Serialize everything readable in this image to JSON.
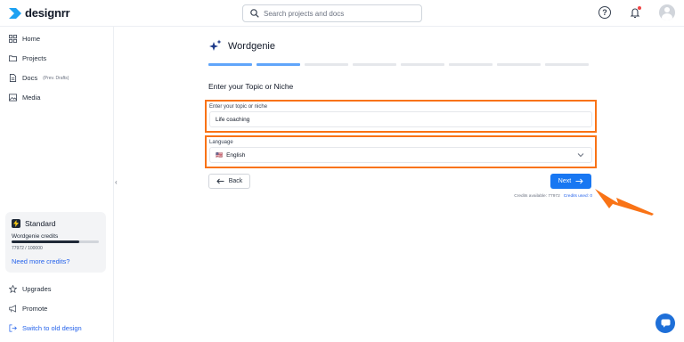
{
  "app": {
    "logo_text": "designrr"
  },
  "search": {
    "placeholder": "Search projects and docs"
  },
  "header": {
    "help_symbol": "?"
  },
  "sidebar": {
    "items": [
      {
        "label": "Home",
        "icon": "grid-icon"
      },
      {
        "label": "Projects",
        "icon": "folder-icon"
      },
      {
        "label": "Docs",
        "sublabel": "(Prev. Drafts)",
        "icon": "document-icon"
      },
      {
        "label": "Media",
        "icon": "image-icon"
      }
    ],
    "plan": {
      "name": "Standard",
      "credits_label": "Wordgenie credits",
      "credits_count": "77972 / 100000",
      "credits_fraction": 0.78,
      "more_credits": "Need more credits?"
    },
    "bottom_items": [
      {
        "label": "Upgrades",
        "icon": "star-icon"
      },
      {
        "label": "Promote",
        "icon": "megaphone-icon"
      },
      {
        "label": "Switch to old design",
        "icon": "switch-icon"
      }
    ],
    "collapse_symbol": "‹"
  },
  "main": {
    "title": "Wordgenie",
    "steps_total": 8,
    "steps_completed": 2,
    "section_title": "Enter your Topic or Niche",
    "topic": {
      "label": "Enter your topic or niche",
      "value": "Life coaching"
    },
    "language": {
      "label": "Language",
      "value": "English",
      "flag": "🇺🇸"
    },
    "back_label": "Back",
    "next_label": "Next",
    "credits_available": "Credits available: 77972",
    "credits_used": "Credits used: 0"
  },
  "colors": {
    "accent": "#1877f2",
    "highlight": "#f97316",
    "progress": "#60a5fa"
  }
}
